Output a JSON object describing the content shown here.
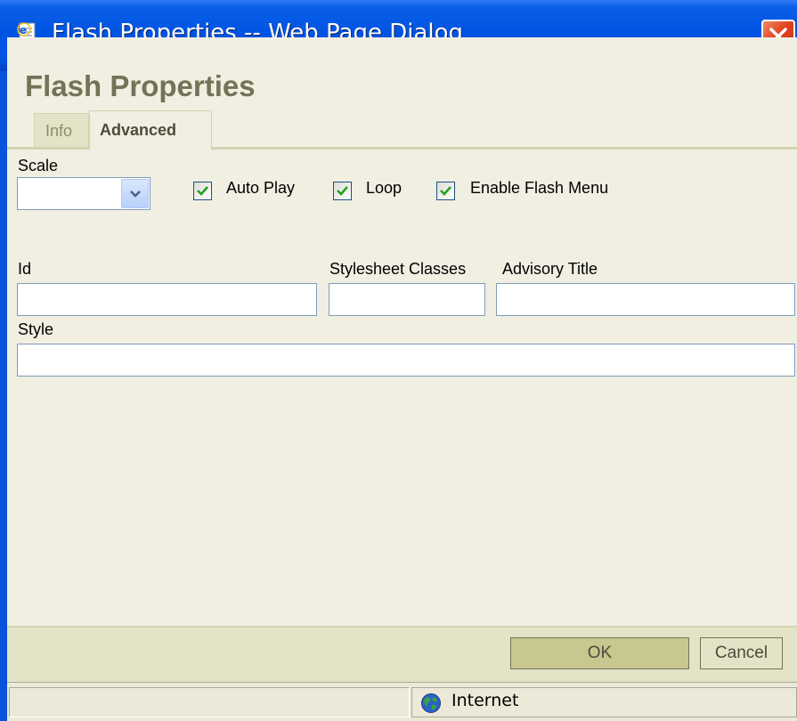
{
  "window": {
    "title": "Flash Properties -- Web Page Dialog",
    "title_icon": "ie-page-icon",
    "close_icon": "close-icon"
  },
  "dialog": {
    "heading": "Flash Properties",
    "tabs": [
      {
        "label": "Info",
        "active": false
      },
      {
        "label": "Advanced",
        "active": true
      }
    ]
  },
  "advanced": {
    "scale_label": "Scale",
    "scale_value": "",
    "checkboxes": [
      {
        "label": "Auto Play",
        "checked": true
      },
      {
        "label": "Loop",
        "checked": true
      },
      {
        "label": "Enable Flash Menu",
        "checked": true
      }
    ],
    "id_label": "Id",
    "id_value": "",
    "classes_label": "Stylesheet Classes",
    "classes_value": "",
    "advisory_label": "Advisory Title",
    "advisory_value": "",
    "style_label": "Style",
    "style_value": ""
  },
  "footer": {
    "ok_label": "OK",
    "cancel_label": "Cancel"
  },
  "statusbar": {
    "zone_icon": "globe-icon",
    "zone_label": "Internet"
  },
  "colors": {
    "titlebar": "#0054e3",
    "dialog_bg": "#f1efe2",
    "heading_text": "#737357",
    "checkbox_check": "#21a121"
  }
}
